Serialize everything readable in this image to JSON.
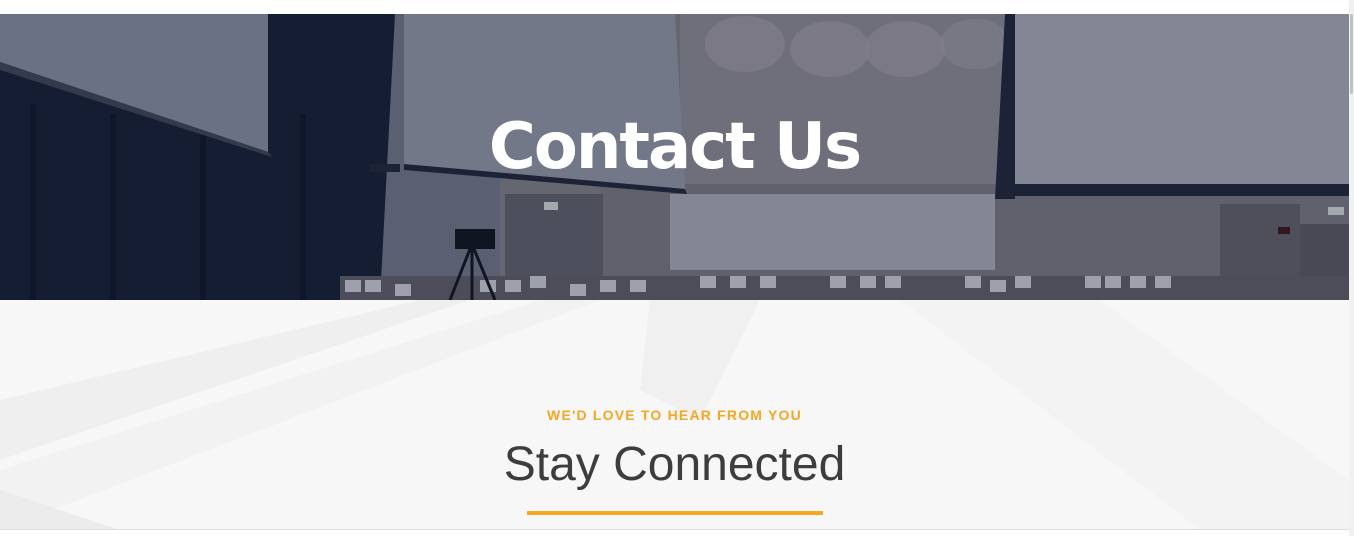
{
  "hero": {
    "title": "Contact Us"
  },
  "intro": {
    "eyebrow": "WE'D LOVE TO HEAR FROM YOU",
    "title": "Stay Connected"
  },
  "colors": {
    "accent": "#f5a623",
    "hero_overlay": "#2b3448",
    "heading": "#3d3d3d"
  }
}
